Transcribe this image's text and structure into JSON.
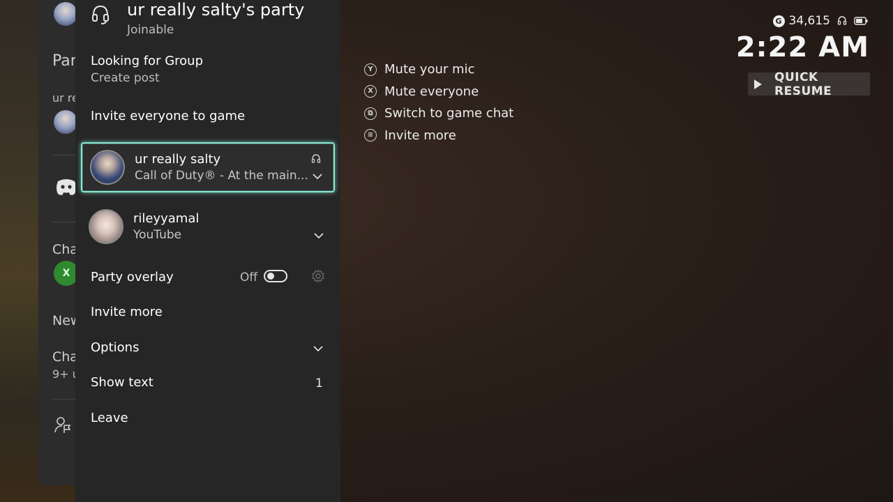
{
  "guide_background": {
    "fragments": [
      "Par",
      "ur re",
      "Cha",
      "New",
      "Cha",
      "9+ u"
    ]
  },
  "party": {
    "title": "ur really salty's party",
    "status": "Joinable",
    "lfg_label": "Looking for Group",
    "lfg_sub": "Create post",
    "invite_everyone_label": "Invite everyone to game",
    "members": [
      {
        "name": "ur really salty",
        "activity": "Call of Duty® - At the main...",
        "focused": true
      },
      {
        "name": "rileyyamal",
        "activity": "YouTube",
        "focused": false
      }
    ],
    "overlay_label": "Party overlay",
    "overlay_state": "Off",
    "invite_more_label": "Invite more",
    "options_label": "Options",
    "show_text_label": "Show text",
    "show_text_count": "1",
    "leave_label": "Leave"
  },
  "hints": [
    {
      "button": "Y",
      "label": "Mute your mic"
    },
    {
      "button": "X",
      "label": "Mute everyone"
    },
    {
      "button": "view",
      "label": "Switch to game chat"
    },
    {
      "button": "menu",
      "label": "Invite more"
    }
  ],
  "status": {
    "gamerscore": "34,615",
    "clock": "2:22 AM",
    "quick_resume": "QUICK RESUME"
  },
  "colors": {
    "focus_ring": "#86e8d2",
    "panel": "#262626"
  }
}
